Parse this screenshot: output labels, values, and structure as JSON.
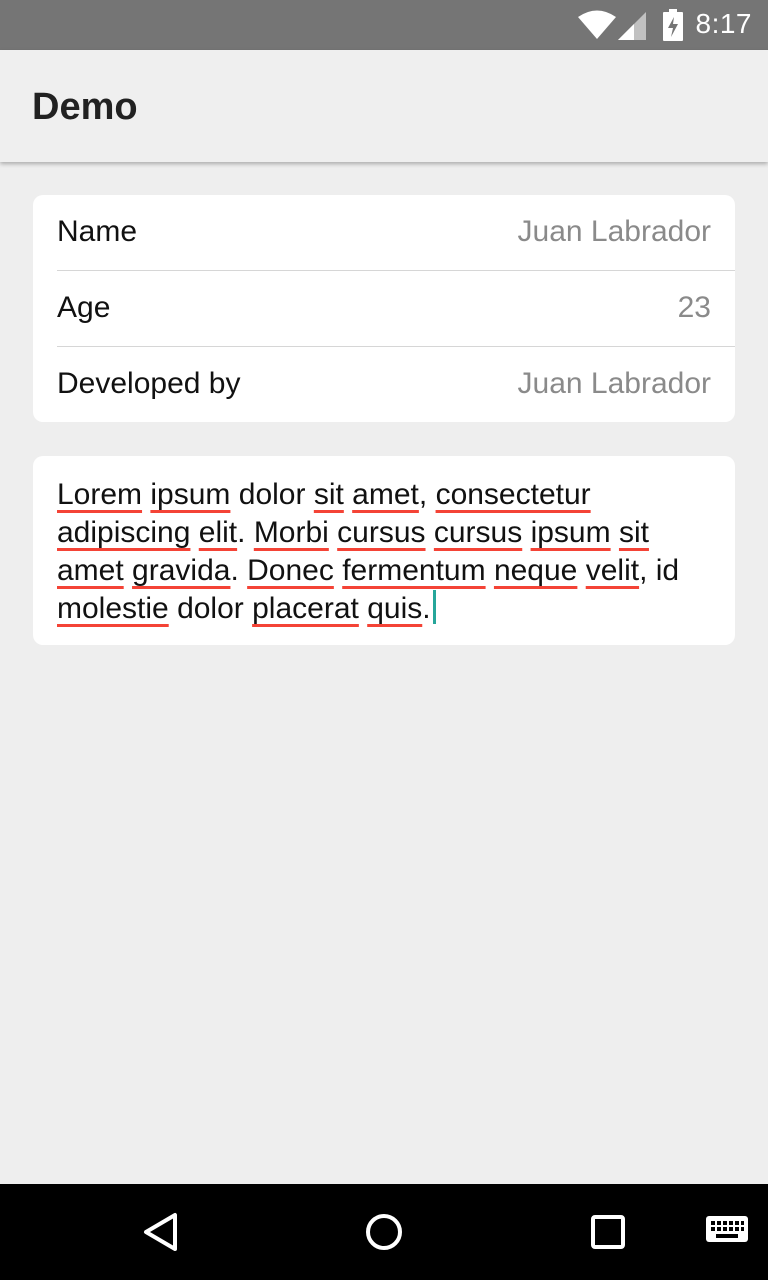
{
  "status_bar": {
    "time": "8:17",
    "icons": [
      "wifi-icon",
      "cell-signal-icon",
      "battery-charging-icon"
    ]
  },
  "app_bar": {
    "title": "Demo"
  },
  "info": {
    "rows": [
      {
        "label": "Name",
        "value": "Juan Labrador"
      },
      {
        "label": "Age",
        "value": "23"
      },
      {
        "label": "Developed by",
        "value": "Juan Labrador"
      }
    ]
  },
  "editor": {
    "words": [
      {
        "text": "Lorem",
        "misspelled": true
      },
      {
        "text": "ipsum",
        "misspelled": true
      },
      {
        "text": "dolor",
        "misspelled": false
      },
      {
        "text": "sit",
        "misspelled": true
      },
      {
        "text": "amet",
        "misspelled": true,
        "after": ","
      },
      {
        "text": "consectetur",
        "misspelled": true
      },
      {
        "text": "adipiscing",
        "misspelled": true
      },
      {
        "text": "elit",
        "misspelled": true,
        "after": "."
      },
      {
        "text": "Morbi",
        "misspelled": true
      },
      {
        "text": "cursus",
        "misspelled": true
      },
      {
        "text": "cursus",
        "misspelled": true
      },
      {
        "text": "ipsum",
        "misspelled": true
      },
      {
        "text": "sit",
        "misspelled": true
      },
      {
        "text": "amet",
        "misspelled": true
      },
      {
        "text": "gravida",
        "misspelled": true,
        "after": "."
      },
      {
        "text": "Donec",
        "misspelled": true
      },
      {
        "text": "fermentum",
        "misspelled": true
      },
      {
        "text": "neque",
        "misspelled": true
      },
      {
        "text": "velit",
        "misspelled": true,
        "after": ","
      },
      {
        "text": "id",
        "misspelled": false
      },
      {
        "text": "molestie",
        "misspelled": true
      },
      {
        "text": "dolor",
        "misspelled": false
      },
      {
        "text": "placerat",
        "misspelled": true
      },
      {
        "text": "quis",
        "misspelled": true,
        "after": "."
      }
    ]
  },
  "nav_bar": {
    "buttons": [
      "back-icon",
      "home-icon",
      "recents-icon",
      "keyboard-icon"
    ]
  },
  "colors": {
    "status_bar": "#757575",
    "app_bar": "#efefef",
    "background": "#eeeeee",
    "spell_underline": "#f44336",
    "caret": "#26a69a"
  }
}
